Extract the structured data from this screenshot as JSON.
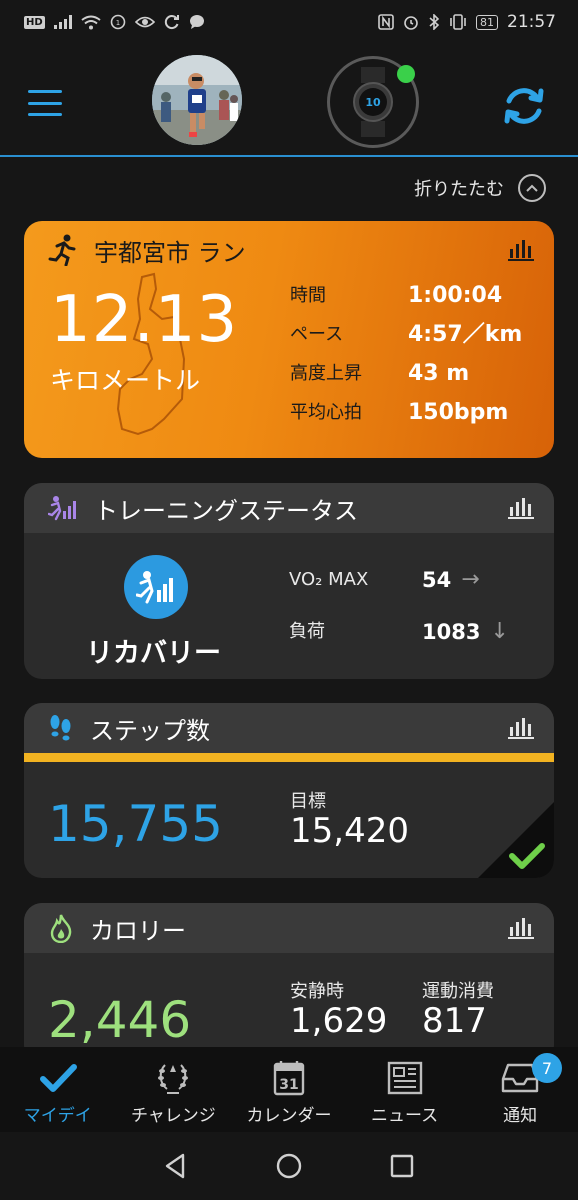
{
  "status_bar": {
    "network": "HD",
    "battery": "81",
    "time": "21:57"
  },
  "header": {
    "collapse_label": "折りたたむ"
  },
  "run_card": {
    "title": "宇都宮市 ラン",
    "distance": "12.13",
    "distance_unit": "キロメートル",
    "stats": [
      {
        "label": "時間",
        "value": "1:00:04"
      },
      {
        "label": "ペース",
        "value": "4:57／km"
      },
      {
        "label": "高度上昇",
        "value": "43 m"
      },
      {
        "label": "平均心拍",
        "value": "150bpm"
      }
    ]
  },
  "training_card": {
    "title": "トレーニングステータス",
    "status": "リカバリー",
    "stats": [
      {
        "label": "VO₂ MAX",
        "value": "54",
        "trend": "→"
      },
      {
        "label": "負荷",
        "value": "1083",
        "trend": "↓"
      }
    ]
  },
  "steps_card": {
    "title": "ステップ数",
    "value": "15,755",
    "goal_label": "目標",
    "goal": "15,420"
  },
  "calories_card": {
    "title": "カロリー",
    "value": "2,446",
    "resting_label": "安静時",
    "resting": "1,629",
    "active_label": "運動消費",
    "active": "817"
  },
  "bottom_nav": {
    "items": [
      {
        "label": "マイデイ"
      },
      {
        "label": "チャレンジ"
      },
      {
        "label": "カレンダー",
        "icon_text": "31"
      },
      {
        "label": "ニュース"
      },
      {
        "label": "通知",
        "badge": "7"
      }
    ]
  },
  "colors": {
    "accent": "#2ea3e6",
    "run_card": "#f49a1c",
    "steps_bar": "#f2b321",
    "calories": "#9ee07e"
  }
}
